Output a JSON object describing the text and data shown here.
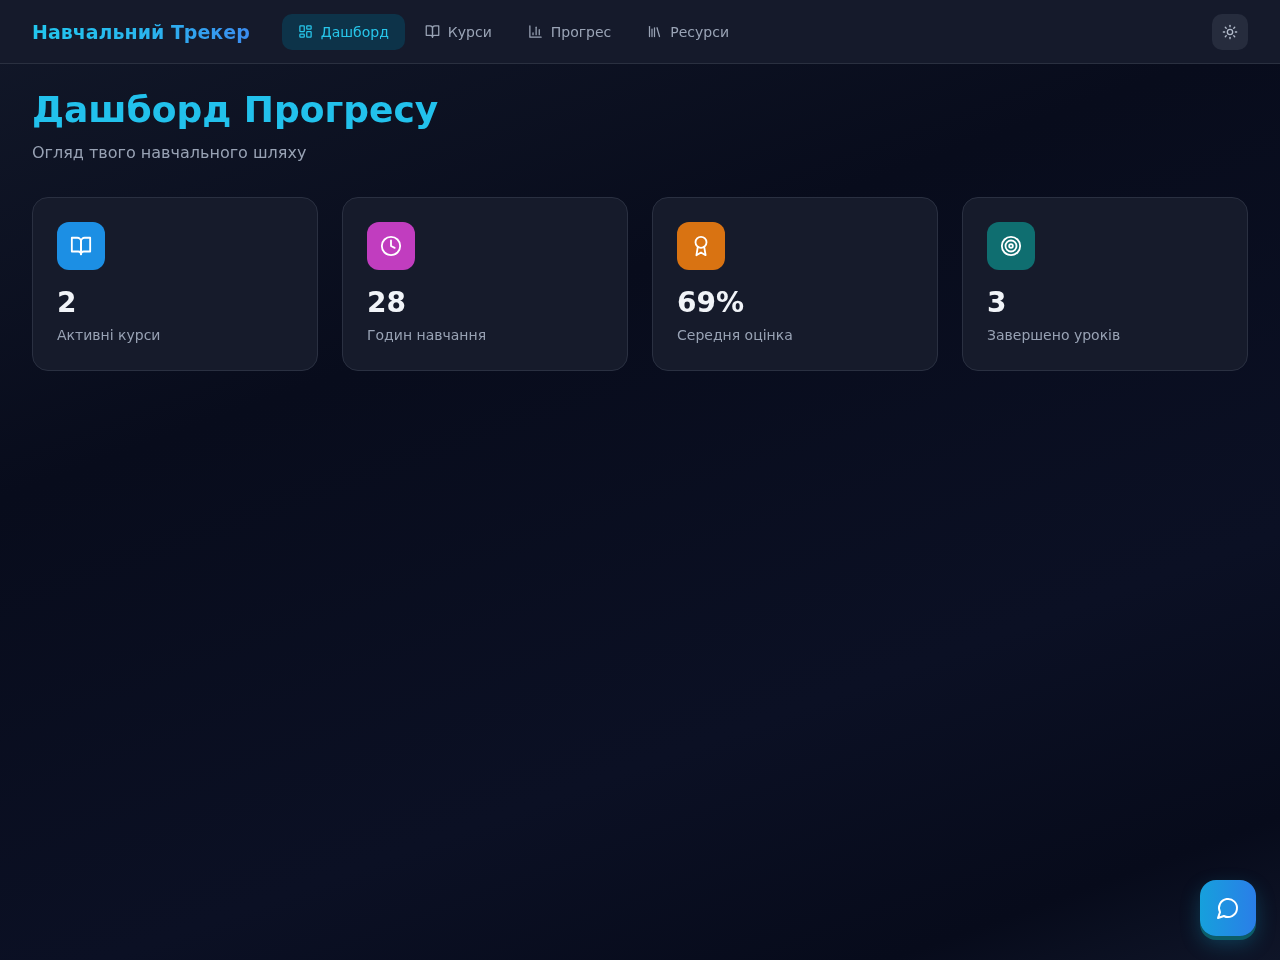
{
  "header": {
    "logo": "Навчальний Трекер",
    "nav": [
      {
        "label": "Дашборд",
        "selected": true
      },
      {
        "label": "Курси",
        "selected": false
      },
      {
        "label": "Прогрес",
        "selected": false
      },
      {
        "label": "Ресурси",
        "selected": false
      }
    ]
  },
  "page": {
    "title": "Дашборд Прогресу",
    "subtitle": "Огляд твого навчального шляху"
  },
  "stats": [
    {
      "value": "2",
      "label": "Активні курси",
      "color": "#1c8fe4"
    },
    {
      "value": "28",
      "label": "Годин навчання",
      "color": "#c13dbf"
    },
    {
      "value": "69%",
      "label": "Середня оцінка",
      "color": "#d97312"
    },
    {
      "value": "3",
      "label": "Завершено уроків",
      "color": "#0f6e70"
    }
  ]
}
